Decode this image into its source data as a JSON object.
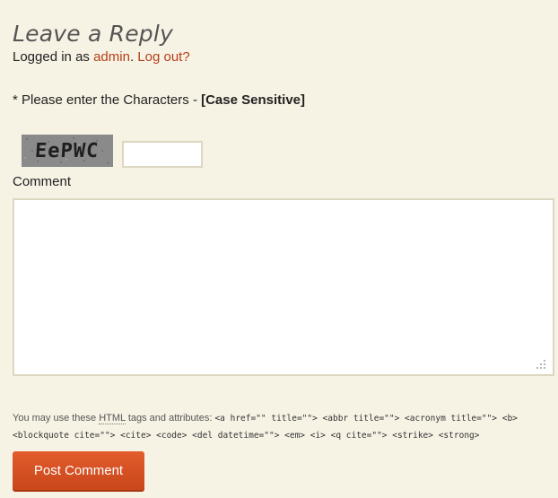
{
  "reply": {
    "title": "Leave a Reply",
    "logged_in_prefix": "Logged in as ",
    "username": "admin",
    "separator": ". ",
    "logout_label": "Log out?"
  },
  "captcha": {
    "prompt": "* Please enter the Characters - ",
    "case_note": "[Case Sensitive]",
    "image_text": "EePWC",
    "input_value": ""
  },
  "comment": {
    "label": "Comment",
    "value": ""
  },
  "allowed_tags": {
    "prefix": "You may use these ",
    "html_abbr": "HTML",
    "middle": " tags and attributes: ",
    "code": "<a href=\"\" title=\"\"> <abbr title=\"\"> <acronym title=\"\"> <b> <blockquote cite=\"\"> <cite> <code> <del datetime=\"\"> <em> <i> <q cite=\"\"> <strike> <strong>"
  },
  "submit": {
    "label": "Post Comment"
  },
  "colors": {
    "background": "#f6f2e4",
    "link": "#b5401a",
    "button": "#d4501f"
  }
}
